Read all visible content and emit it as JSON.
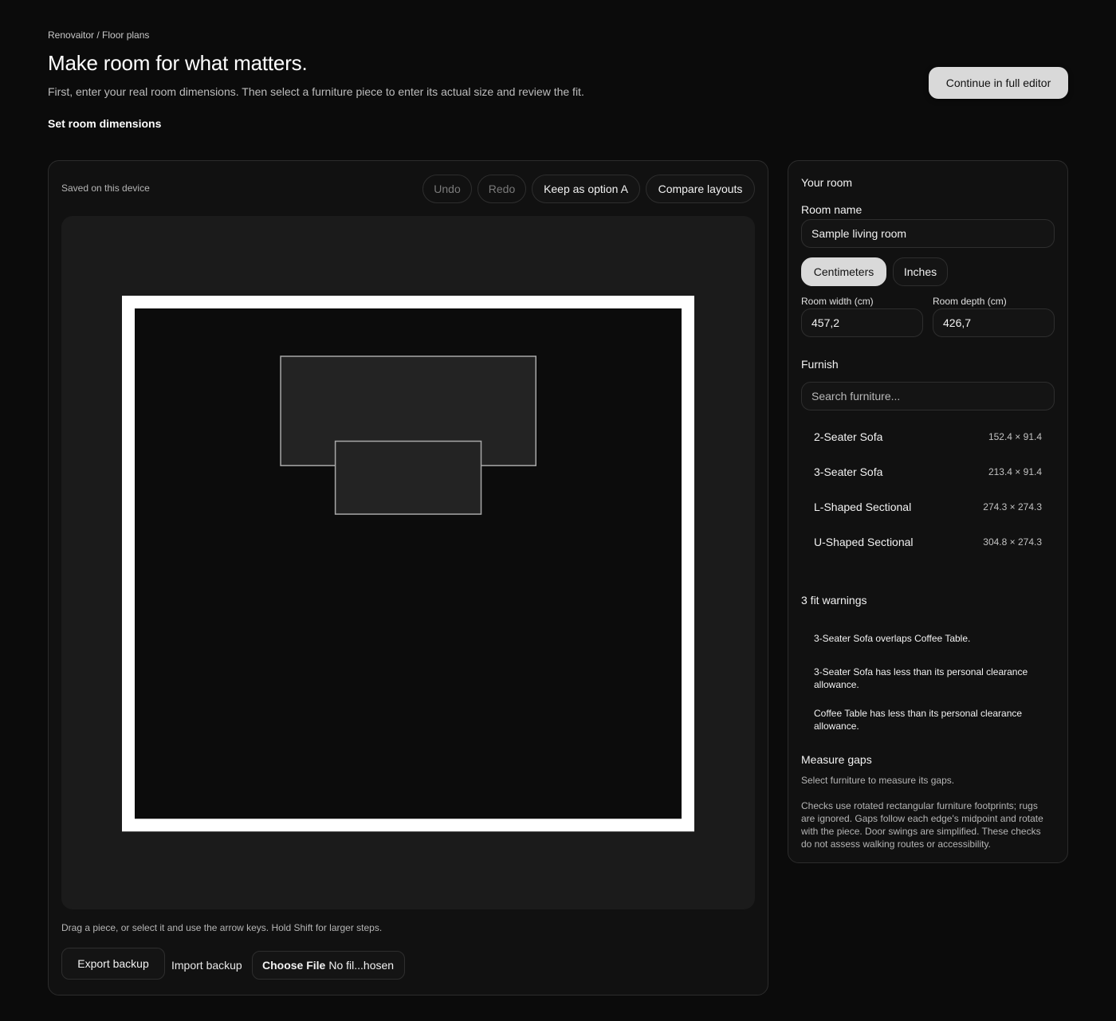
{
  "breadcrumb": "Renovaitor / Floor plans",
  "title": "Make room for what matters.",
  "subtitle": "First, enter your real room dimensions. Then select a furniture piece to enter its actual size and review the fit.",
  "set_dimensions_link": "Set room dimensions",
  "continue_button": "Continue in full editor",
  "toolbar": {
    "saved_status": "Saved on this device",
    "undo": "Undo",
    "redo": "Redo",
    "keep_option": "Keep as option A",
    "compare": "Compare layouts"
  },
  "canvas": {
    "room_width_cm": 457.2,
    "room_depth_cm": 426.7,
    "pieces": [
      {
        "name": "3-Seater Sofa",
        "width_cm": 213.4,
        "depth_cm": 91.4,
        "x_cm": 122.0,
        "y_cm": 40.0
      },
      {
        "name": "Coffee Table",
        "width_cm": 121.9,
        "depth_cm": 61.0,
        "x_cm": 167.7,
        "y_cm": 111.0
      }
    ]
  },
  "hint": "Drag a piece, or select it and use the arrow keys. Hold Shift for larger steps.",
  "export_backup": "Export backup",
  "import_backup": "Import backup",
  "file_input": {
    "choose": "Choose File",
    "status": "No fil...hosen"
  },
  "side": {
    "your_room": "Your room",
    "room_name_label": "Room name",
    "room_name_value": "Sample living room",
    "units": [
      "Centimeters",
      "Inches"
    ],
    "width_label": "Room width (cm)",
    "width_value": "457,2",
    "depth_label": "Room depth (cm)",
    "depth_value": "426,7",
    "furnish": "Furnish",
    "search_placeholder": "Search furniture...",
    "furniture": [
      {
        "name": "2-Seater Sofa",
        "size": "152.4 × 91.4"
      },
      {
        "name": "3-Seater Sofa",
        "size": "213.4 × 91.4"
      },
      {
        "name": "L-Shaped Sectional",
        "size": "274.3 × 274.3"
      },
      {
        "name": "U-Shaped Sectional",
        "size": "304.8 × 274.3"
      }
    ],
    "warnings_title": "3 fit warnings",
    "warnings": [
      "3-Seater Sofa overlaps Coffee Table.",
      "3-Seater Sofa has less than its personal clearance allowance.",
      "Coffee Table has less than its personal clearance allowance."
    ],
    "measure_gaps": "Measure gaps",
    "measure_hint": "Select furniture to measure its gaps.",
    "footnote": "Checks use rotated rectangular furniture footprints; rugs are ignored. Gaps follow each edge's midpoint and rotate with the piece. Door swings are simplified. These checks do not assess walking routes or accessibility."
  }
}
